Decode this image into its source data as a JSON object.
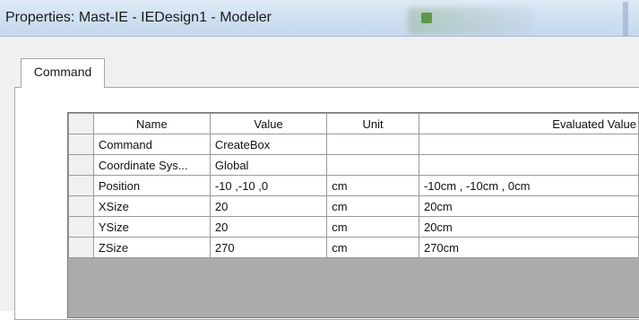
{
  "window": {
    "title": "Properties: Mast-IE - IEDesign1 - Modeler"
  },
  "tabs": [
    {
      "label": "Command"
    }
  ],
  "table": {
    "headers": {
      "name": "Name",
      "value": "Value",
      "unit": "Unit",
      "evaluated": "Evaluated Value"
    },
    "rows": [
      {
        "name": "Command",
        "value": "CreateBox",
        "unit": "",
        "evaluated": ""
      },
      {
        "name": "Coordinate Sys...",
        "value": "Global",
        "unit": "",
        "evaluated": ""
      },
      {
        "name": "Position",
        "value": "-10 ,-10 ,0",
        "unit": "cm",
        "evaluated": "-10cm , -10cm , 0cm"
      },
      {
        "name": "XSize",
        "value": "20",
        "unit": "cm",
        "evaluated": "20cm"
      },
      {
        "name": "YSize",
        "value": "20",
        "unit": "cm",
        "evaluated": "20cm"
      },
      {
        "name": "ZSize",
        "value": "270",
        "unit": "cm",
        "evaluated": "270cm"
      }
    ]
  }
}
